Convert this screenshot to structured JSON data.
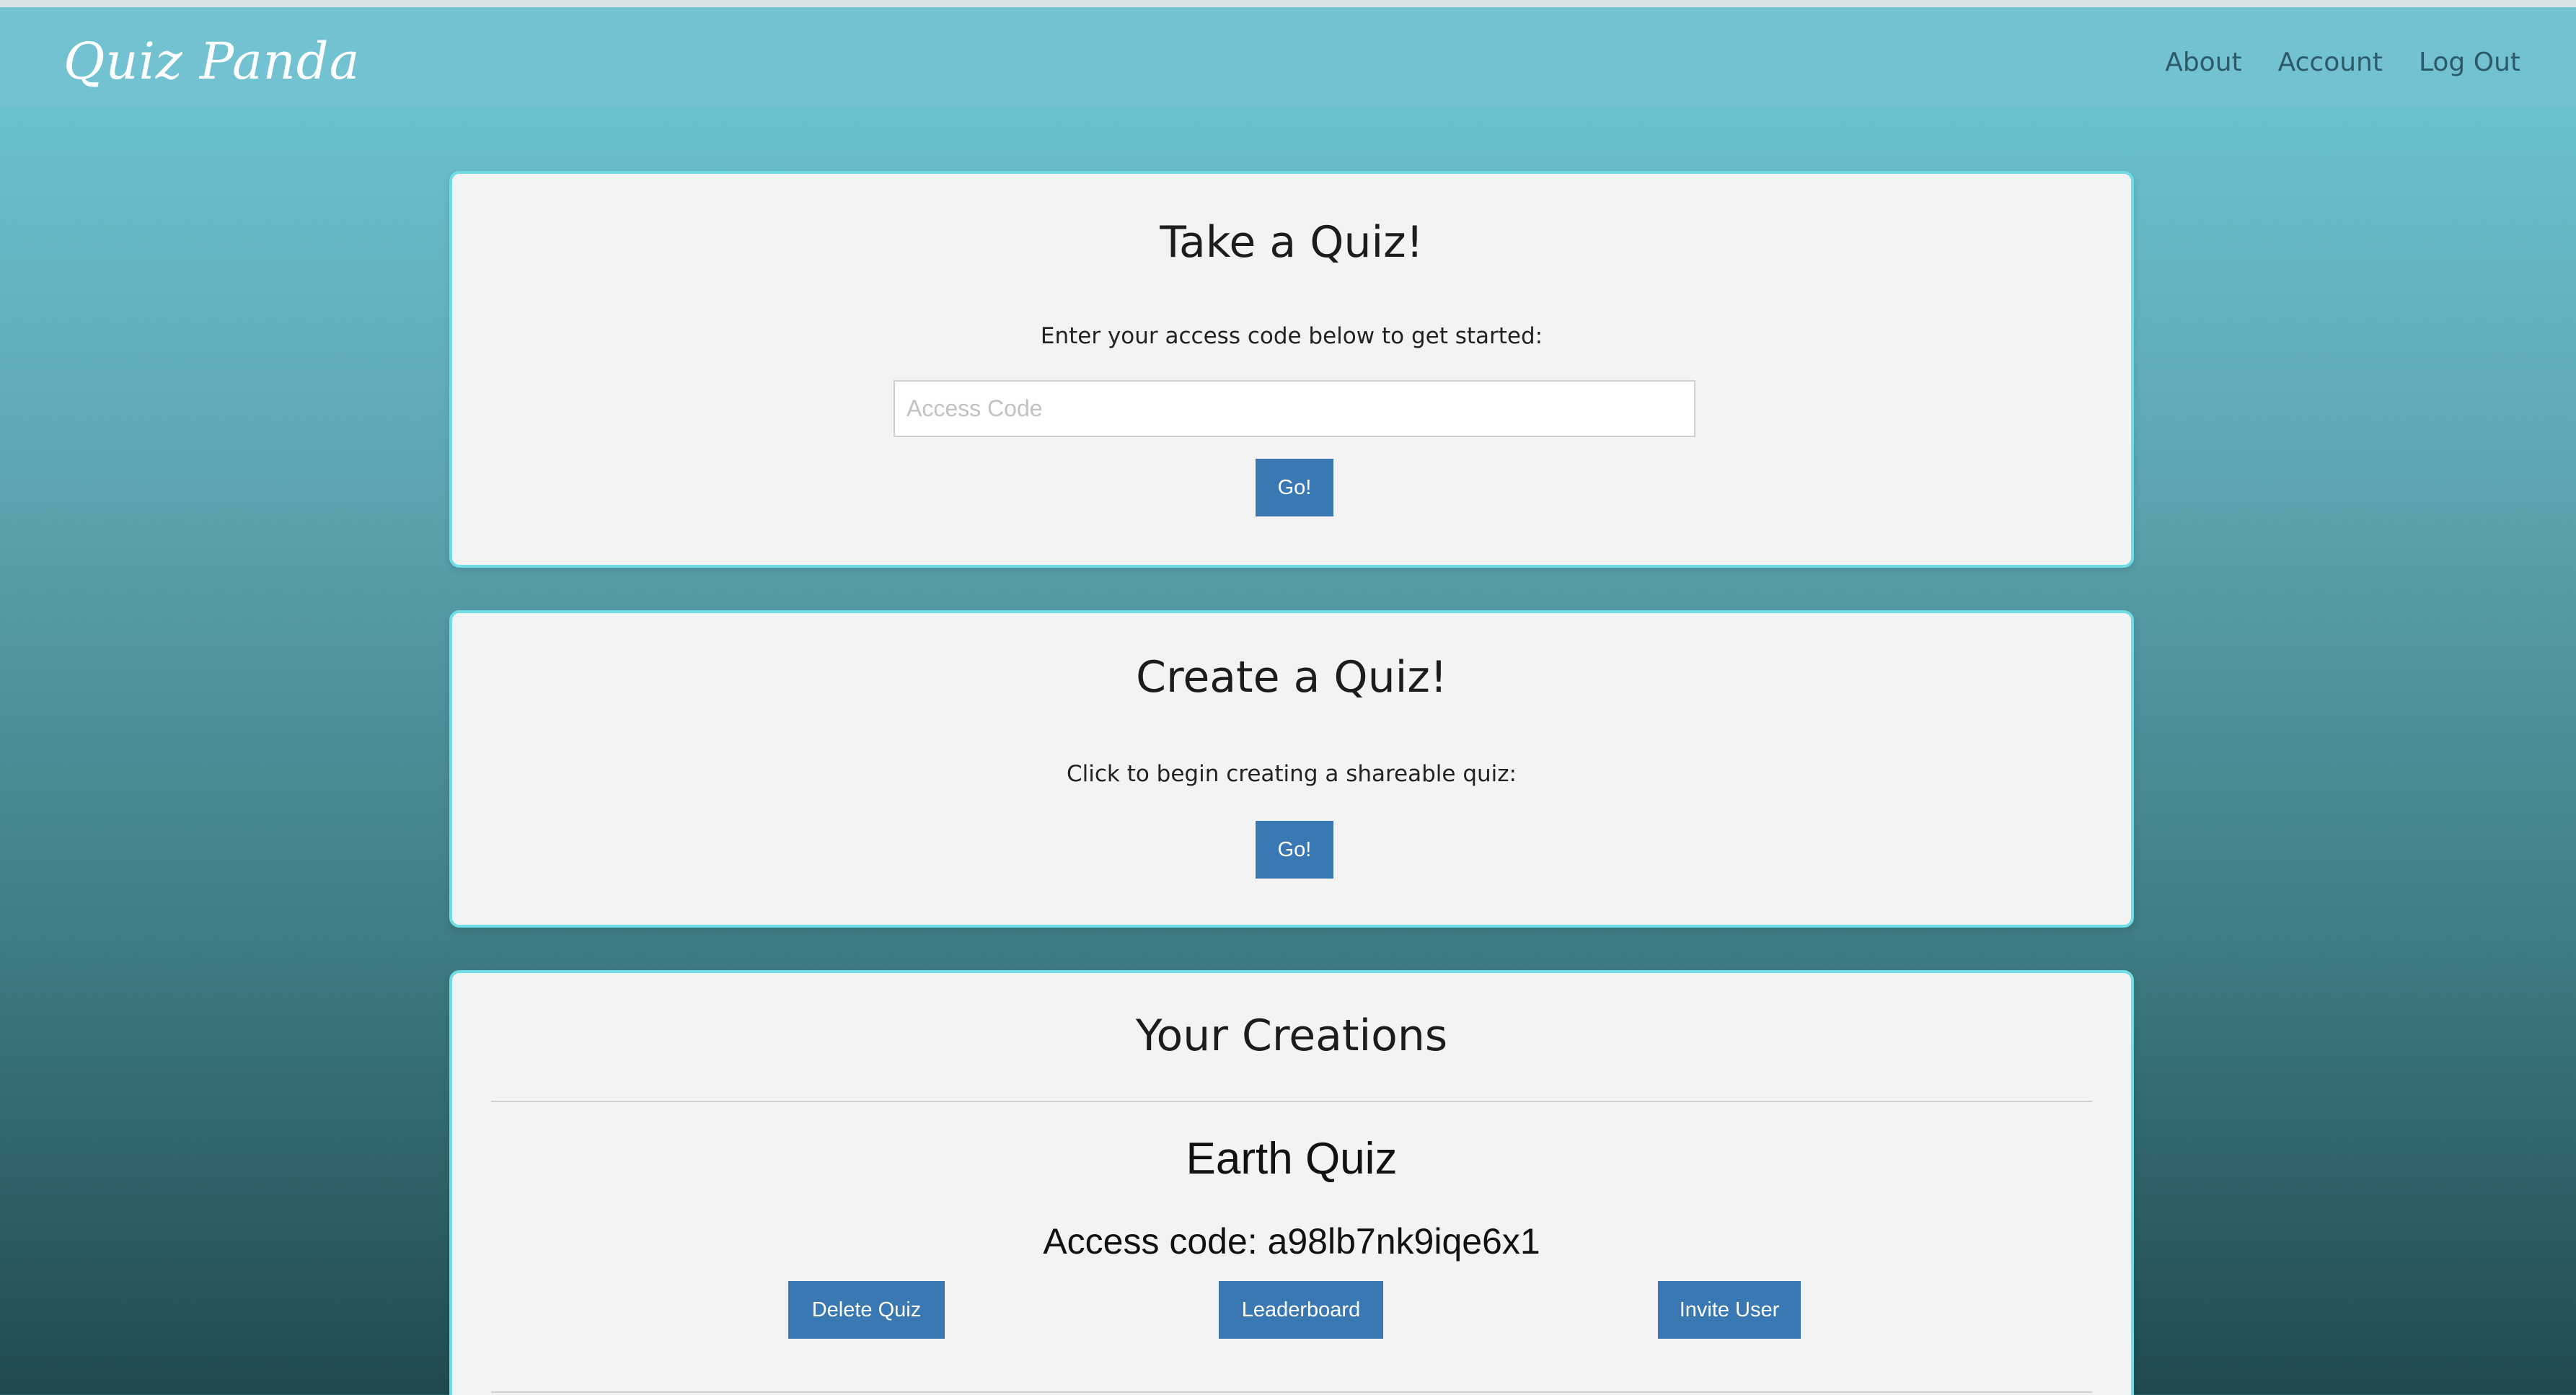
{
  "nav": {
    "brand": "Quiz Panda",
    "links": [
      "About",
      "Account",
      "Log Out"
    ]
  },
  "take_quiz": {
    "title": "Take a Quiz!",
    "instruction": "Enter your access code below to get started:",
    "input_placeholder": "Access Code",
    "button": "Go!"
  },
  "create_quiz": {
    "title": "Create a Quiz!",
    "instruction": "Click to begin creating a shareable quiz:",
    "button": "Go!"
  },
  "creations": {
    "title": "Your Creations",
    "quizzes": [
      {
        "name": "Earth Quiz",
        "access_code": "Access code: a98lb7nk9iqe6x1",
        "actions": [
          "Delete Quiz",
          "Leaderboard",
          "Invite User"
        ]
      }
    ]
  }
}
